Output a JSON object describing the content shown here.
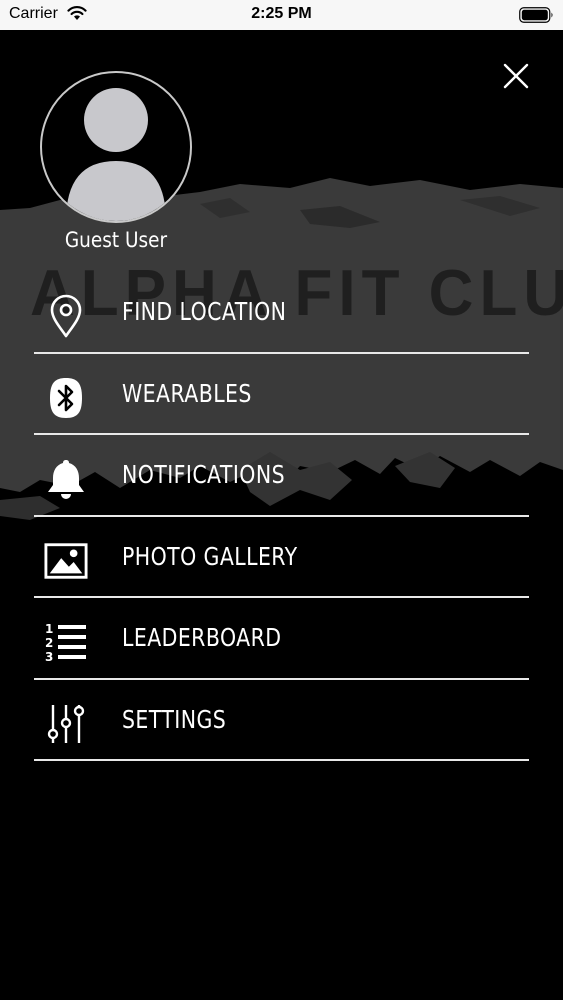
{
  "status_bar": {
    "carrier": "Carrier",
    "time": "2:25 PM",
    "wifi_icon": "wifi-icon",
    "battery_icon": "battery-full-icon"
  },
  "background": {
    "brand_watermark": "ALPHA FIT CLUB"
  },
  "drawer": {
    "close_icon": "close-icon",
    "avatar_icon": "user-placeholder-icon",
    "user_name": "Guest User",
    "menu": [
      {
        "label": "FIND LOCATION",
        "icon": "map-pin-icon"
      },
      {
        "label": "WEARABLES",
        "icon": "bluetooth-icon"
      },
      {
        "label": "NOTIFICATIONS",
        "icon": "bell-icon"
      },
      {
        "label": "PHOTO GALLERY",
        "icon": "image-icon"
      },
      {
        "label": "LEADERBOARD",
        "icon": "ranked-list-icon"
      },
      {
        "label": "SETTINGS",
        "icon": "sliders-icon"
      }
    ]
  },
  "colors": {
    "background": "#000000",
    "brush_texture": "#3a3a3a",
    "text": "#ffffff",
    "divider": "#e8e8e8",
    "avatar_fill": "#c8c8cc"
  }
}
